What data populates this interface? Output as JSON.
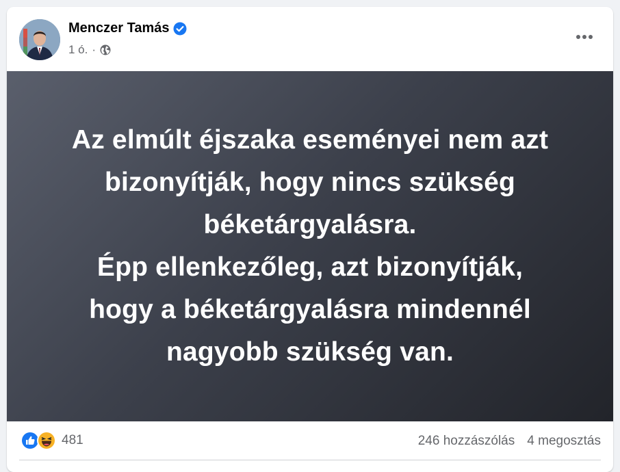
{
  "post": {
    "author": "Menczer Tamás",
    "time": "1 ó.",
    "separator": "·",
    "image_text": "Az elmúlt éjszaka eseményei nem azt\nbizonyítják, hogy nincs szükség\nbéketárgyalásra.\nÉpp ellenkezőleg, azt bizonyítják,\nhogy a béketárgyalásra mindennél\nnagyobb szükség van."
  },
  "stats": {
    "reaction_count": "481",
    "comments": "246 hozzászólás",
    "shares": "4 megosztás"
  },
  "icons": {
    "verified": "verified-badge-icon",
    "privacy": "globe-icon",
    "more": "more-options-icon",
    "reactions": [
      "like-reaction-icon",
      "haha-reaction-icon"
    ]
  },
  "colors": {
    "verified": "#1877f2",
    "like": "#1877f2",
    "haha": "#f7b125",
    "secondary_text": "#65676b"
  }
}
